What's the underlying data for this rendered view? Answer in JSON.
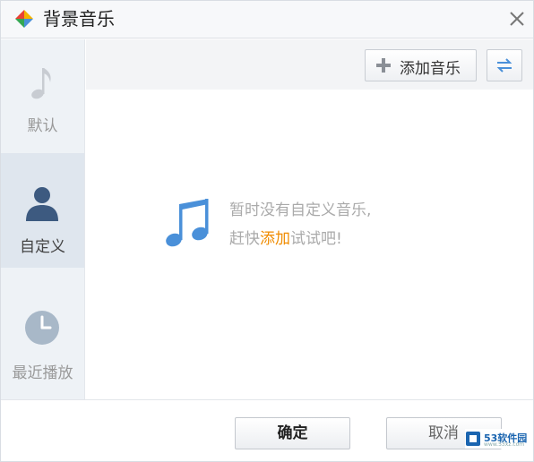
{
  "window": {
    "title": "背景音乐",
    "close_icon": "close-icon"
  },
  "sidebar": {
    "items": [
      {
        "label": "默认",
        "icon": "music-note-icon",
        "active": false
      },
      {
        "label": "自定义",
        "icon": "user-icon",
        "active": true
      },
      {
        "label": "最近播放",
        "icon": "clock-icon",
        "active": false
      }
    ]
  },
  "toolbar": {
    "add_music_label": "添加音乐",
    "add_icon": "plus-icon",
    "swap_icon": "swap-arrows-icon"
  },
  "content": {
    "empty_line1": "暂时没有自定义音乐,",
    "empty_line2_prefix": "赶快",
    "empty_line2_link": "添加",
    "empty_line2_suffix": "试试吧!",
    "empty_icon": "music-note-icon"
  },
  "footer": {
    "ok_label": "确定",
    "cancel_label": "取消"
  },
  "watermark": {
    "text": "53软件园",
    "url": "www.53xz.com"
  },
  "colors": {
    "accent_link": "#f08c00",
    "icon_blue": "#4a90d9",
    "sidebar_bg": "#eef2f6",
    "sidebar_active": "#dfe6ee"
  }
}
